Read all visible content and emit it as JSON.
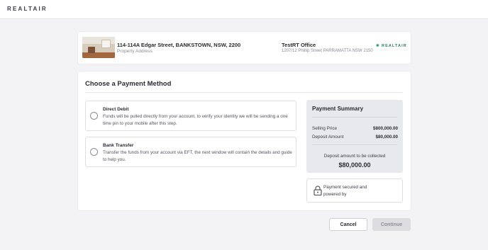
{
  "brand": {
    "logo_text": "REALTAIR"
  },
  "property": {
    "address": "114-114A Edgar Street, BANKSTOWN, NSW, 2200",
    "address_label": "Property Address",
    "office_name": "TestRT Office",
    "office_address": "1207/12 Phillip Street PARRAMATTA NSW 2150",
    "office_logo_text": "REALTAIR"
  },
  "payment": {
    "title": "Choose a Payment Method",
    "options": [
      {
        "title": "Direct Debit",
        "description": "Funds will be pulled directly from your account, to verify your identity we will be sending a one time pin to your mobile after this step.",
        "selected": false
      },
      {
        "title": "Bank Transfer",
        "description": "Transfer the funds from your account via EFT, the next window will contain the details and guide to help you.",
        "selected": false
      }
    ]
  },
  "summary": {
    "title": "Payment Summary",
    "rows": [
      {
        "label": "Selling Price",
        "value": "$800,000.00"
      },
      {
        "label": "Deposit Amount",
        "value": "$80,000.00"
      }
    ],
    "collected_label": "Deposit amount to be collected",
    "collected_value": "$80,000.00"
  },
  "secure": {
    "text": "Payment secured and powered by"
  },
  "actions": {
    "cancel_label": "Cancel",
    "continue_label": "Continue"
  },
  "colors": {
    "accent_green": "#2e7d5e",
    "disabled_button": "#dcdce1",
    "summary_bg": "#e8e8ef"
  }
}
